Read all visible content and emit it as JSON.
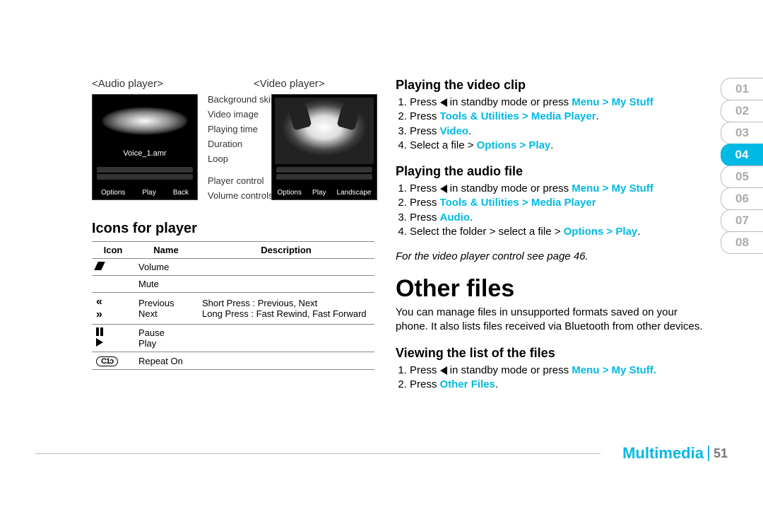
{
  "labels": {
    "audio_player": "<Audio player>",
    "video_player": "<Video player>",
    "clip_name": "Voice_1.amr"
  },
  "audio_opts": [
    "Options",
    "Play",
    "Back"
  ],
  "video_opts": [
    "Options",
    "Play",
    "Landscape"
  ],
  "callouts": {
    "bg_skin": "Background skin",
    "video_img": "Video image",
    "playtime": "Playing time",
    "duration": "Duration",
    "loop": "Loop",
    "player_ctrl": "Player control",
    "vol_ctrl": "Volume controls"
  },
  "icons_heading": "Icons for player",
  "icons_table": {
    "headers": [
      "Icon",
      "Name",
      "Description"
    ],
    "rows": [
      {
        "name": "Volume",
        "desc": ""
      },
      {
        "name": "Mute",
        "desc": ""
      },
      {
        "name": "Previous\nNext",
        "desc": "Short Press : Previous, Next\nLong Press : Fast Rewind, Fast Forward"
      },
      {
        "name": "Pause\nPlay",
        "desc": ""
      },
      {
        "name": "Repeat On",
        "desc": ""
      }
    ]
  },
  "right": {
    "video_h": "Playing the video clip",
    "audio_h": "Playing the audio file",
    "viewing_h": "Viewing the list of the files",
    "main_h": "Other files",
    "press_word": "Press ",
    "standby_or_press": " in standby mode or press ",
    "menu": "Menu",
    "gt": " > ",
    "mystuff": "My Stuff",
    "mystuff_dot": "My Stuff.",
    "tools": "Tools & Utilities",
    "media": "Media Player",
    "video": "Video",
    "audio": "Audio",
    "options": "Options",
    "play": "Play",
    "select_file": "Select a file > ",
    "select_folder": "Select the folder > select a file > ",
    "other_files": "Other Files",
    "note": "For the video player control see page 46.",
    "body": "You can manage files in unsupported formats saved on your phone. It also lists files received via Bluetooth from other devices.",
    "period": "."
  },
  "tabs": [
    "01",
    "02",
    "03",
    "04",
    "05",
    "06",
    "07",
    "08"
  ],
  "footer": {
    "category": "Multimedia",
    "page": "51"
  }
}
